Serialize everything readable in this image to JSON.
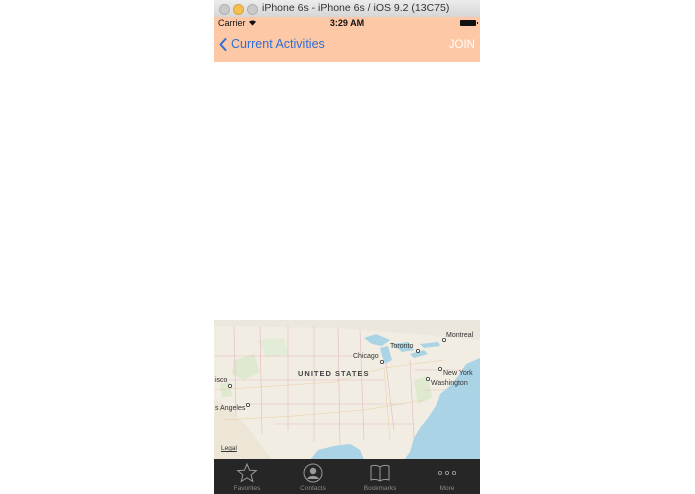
{
  "window": {
    "title": "iPhone 6s - iPhone 6s / iOS 9.2 (13C75)"
  },
  "status": {
    "carrier": "Carrier",
    "time": "3:29 AM"
  },
  "nav": {
    "back_label": "Current Activities",
    "join_label": "JOIN",
    "bar_color": "#fdc8a5",
    "tint": "#2f6fd6"
  },
  "map": {
    "country": "UNITED STATES",
    "cities": {
      "montreal": "Montreal",
      "toronto": "Toronto",
      "chicago": "Chicago",
      "new_york": "New York",
      "washington": "Washington",
      "san_francisco": "isco",
      "los_angeles": "s Angeles"
    },
    "legal": "Legal"
  },
  "tabs": {
    "favorites": "Favorites",
    "contacts": "Contacts",
    "bookmarks": "Bookmarks",
    "more": "More"
  }
}
